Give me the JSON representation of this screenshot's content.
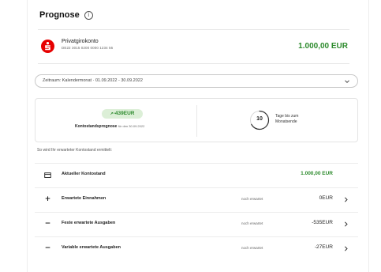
{
  "header": {
    "title": "Prognose",
    "info_icon": "info-circle-icon"
  },
  "account": {
    "logo_icon": "sparkasse-logo-icon",
    "brand_color": "#e60000",
    "name": "Privatgirokonto",
    "iban": "DE22 3015 0200 0000 1234 56",
    "balance": "1.000,00 EUR",
    "balance_color": "#2c8a2c"
  },
  "period": {
    "label": "Zeitraum: Kalendermonat · 01.09.2022 - 30.09.2022",
    "icon": "chevron-down-icon"
  },
  "forecast": {
    "amount": "-439EUR",
    "label_bold": "Kontostandsprognose",
    "label_sub": "für den 30.09.2022",
    "days_value": "10",
    "days_label": "Tage bis zum Monatsende",
    "days_progress": 0.67
  },
  "section_caption": "So wird Ihr erwarteter Kontostand ermittelt:",
  "rows": [
    {
      "icon": "wallet-icon",
      "icon_glyph": "▭",
      "label": "Aktueller Kontostand",
      "status": "",
      "amount": "1.000,00 EUR",
      "green": true,
      "chevron": false
    },
    {
      "icon": "plus-icon",
      "icon_glyph": "+",
      "label": "Erwartete Einnahmen",
      "status": "noch erwartet",
      "amount": "0EUR",
      "green": false,
      "chevron": true
    },
    {
      "icon": "minus-icon",
      "icon_glyph": "−",
      "label": "Feste erwartete Ausgaben",
      "status": "noch erwartet",
      "amount": "-535EUR",
      "green": false,
      "chevron": true
    },
    {
      "icon": "minus-icon",
      "icon_glyph": "−",
      "label": "Variable erwartete Ausgaben",
      "status": "noch erwartet",
      "amount": "-27EUR",
      "green": false,
      "chevron": true
    }
  ]
}
